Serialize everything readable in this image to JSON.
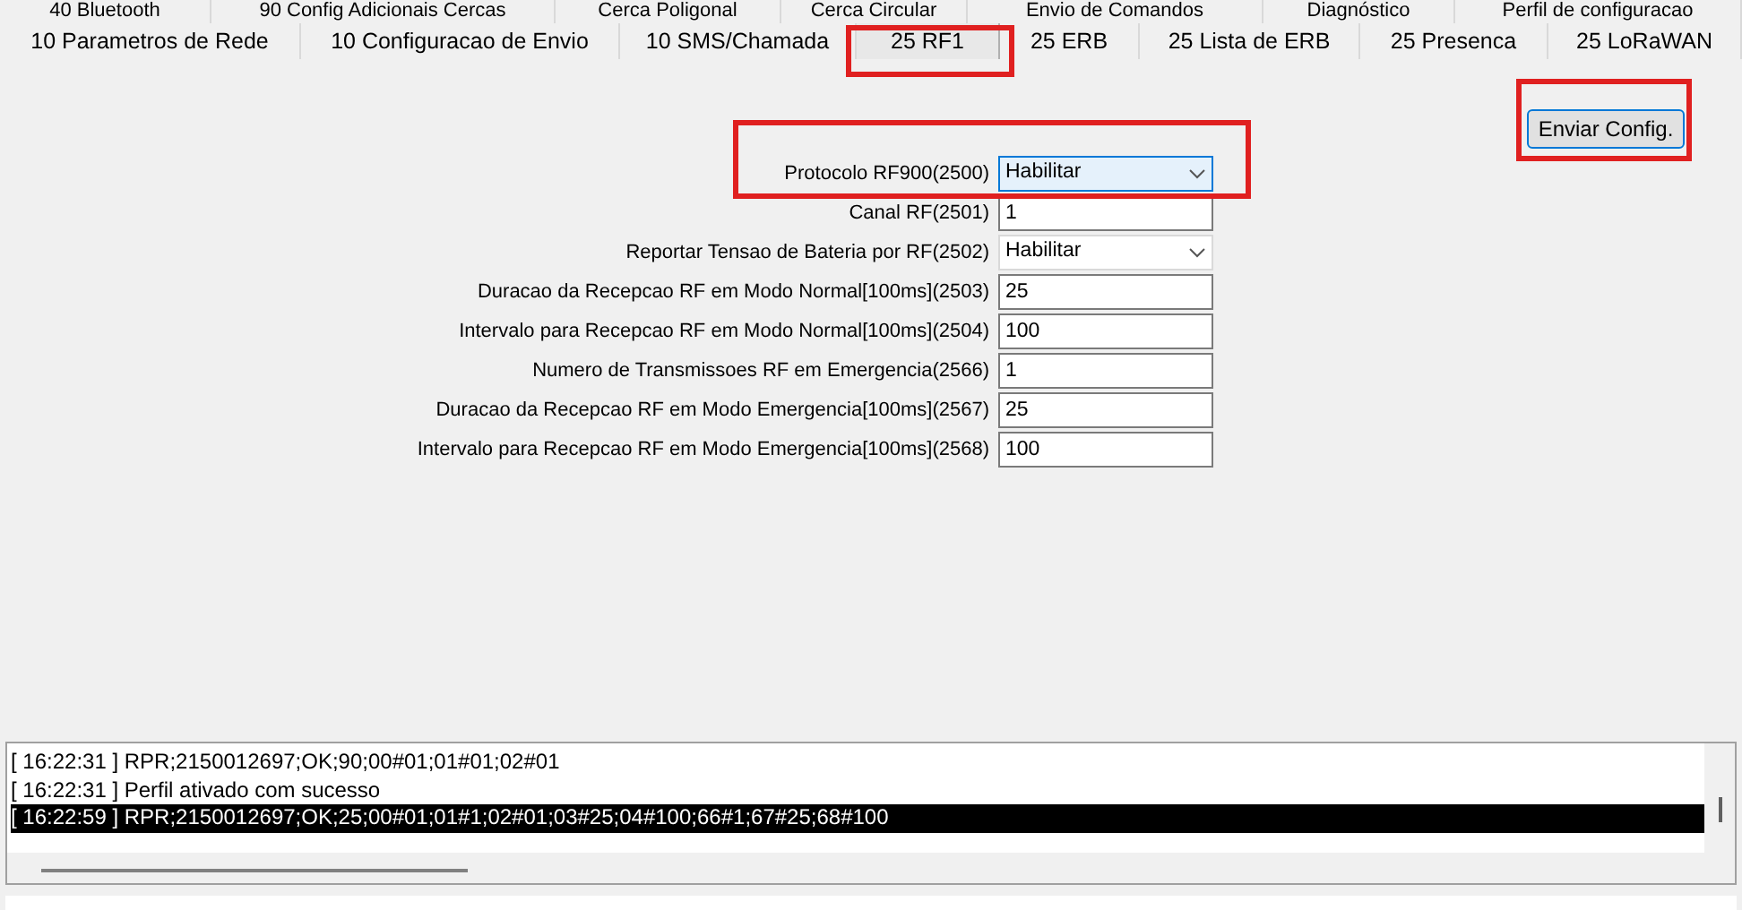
{
  "tabs_row_1": [
    {
      "label": "40 Bluetooth",
      "selected": false
    },
    {
      "label": "90 Config Adicionais Cercas",
      "selected": false
    },
    {
      "label": "Cerca Poligonal",
      "selected": false
    },
    {
      "label": "Cerca Circular",
      "selected": false
    },
    {
      "label": "Envio de Comandos",
      "selected": false
    },
    {
      "label": "Diagnóstico",
      "selected": false
    },
    {
      "label": "Perfil de configuracao",
      "selected": false
    }
  ],
  "tabs_row_2": [
    {
      "label": "10 Parametros de Rede",
      "selected": false
    },
    {
      "label": "10 Configuracao de Envio",
      "selected": false
    },
    {
      "label": "10 SMS/Chamada",
      "selected": false
    },
    {
      "label": "25 RF1",
      "selected": true
    },
    {
      "label": "25 ERB",
      "selected": false
    },
    {
      "label": "25 Lista de ERB",
      "selected": false
    },
    {
      "label": "25 Presenca",
      "selected": false
    },
    {
      "label": "25 LoRaWAN",
      "selected": false
    }
  ],
  "send_button": "Enviar Config.",
  "fields": [
    {
      "label": "Protocolo RF900(2500)",
      "kind": "select",
      "value": "Habilitar",
      "focused": true
    },
    {
      "label": "Canal RF(2501)",
      "kind": "text",
      "value": "1"
    },
    {
      "label": "Reportar Tensao de Bateria por RF(2502)",
      "kind": "select",
      "value": "Habilitar",
      "focused": false
    },
    {
      "label": "Duracao da Recepcao RF em Modo Normal[100ms](2503)",
      "kind": "text",
      "value": "25"
    },
    {
      "label": "Intervalo para Recepcao RF em Modo Normal[100ms](2504)",
      "kind": "text",
      "value": "100"
    },
    {
      "label": "Numero de Transmissoes RF em Emergencia(2566)",
      "kind": "text",
      "value": "1"
    },
    {
      "label": "Duracao da Recepcao RF em Modo Emergencia[100ms](2567)",
      "kind": "text",
      "value": "25"
    },
    {
      "label": "Intervalo para Recepcao RF em Modo Emergencia[100ms](2568)",
      "kind": "text",
      "value": "100"
    }
  ],
  "log": [
    {
      "text": "[ 16:22:31 ] RPR;2150012697;OK;90;00#01;01#01;02#01",
      "selected": false
    },
    {
      "text": "[ 16:22:31 ] Perfil ativado com sucesso",
      "selected": false
    },
    {
      "text": "[ 16:22:59 ] RPR;2150012697;OK;25;00#01;01#1;02#01;03#25;04#100;66#1;67#25;68#100",
      "selected": true
    }
  ]
}
